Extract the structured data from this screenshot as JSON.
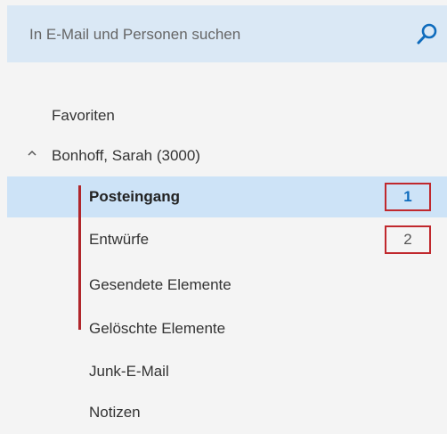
{
  "search": {
    "placeholder": "In E-Mail und Personen suchen",
    "icon": "search-icon"
  },
  "folders": {
    "favorites_label": "Favoriten",
    "account_label": "Bonhoff, Sarah (3000)",
    "account_chevron": "chevron-up-icon",
    "items": [
      {
        "label": "Posteingang",
        "count": "1",
        "selected": true,
        "bold": true
      },
      {
        "label": "Entwürfe",
        "count": "2",
        "selected": false
      },
      {
        "label": "Gesendete Elemente"
      },
      {
        "label": "Gelöschte Elemente"
      },
      {
        "label": "Junk-E-Mail"
      },
      {
        "label": "Notizen"
      }
    ]
  },
  "colors": {
    "search_bg": "#dae8f5",
    "selected_bg": "#cde3f7",
    "accent_blue": "#0f6cbd",
    "annotation_red": "#c0282d"
  }
}
